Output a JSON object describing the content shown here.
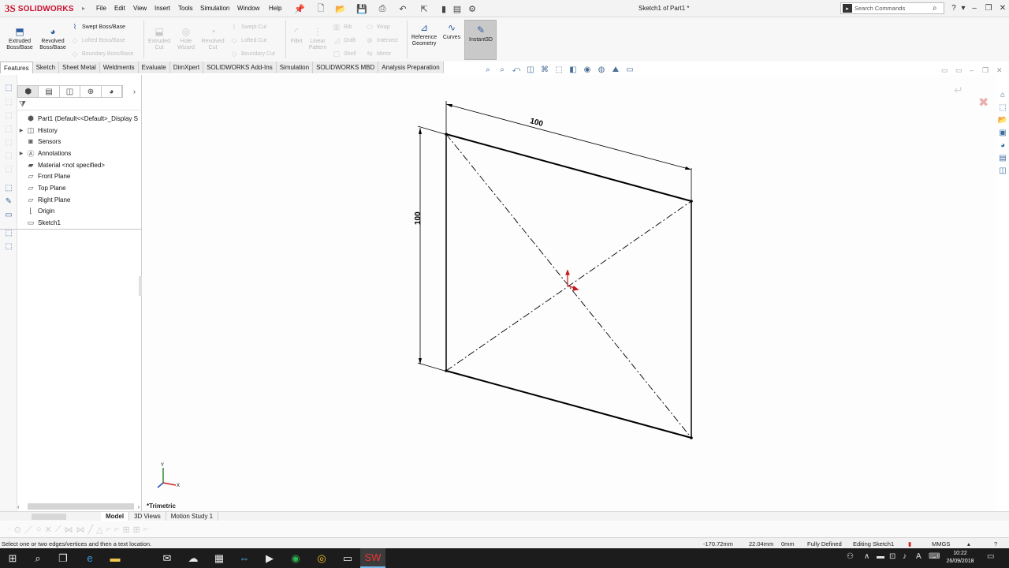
{
  "app": {
    "logo_ds": "3S",
    "logo_name": "SOLIDWORKS",
    "doc_title": "Sketch1 of Part1 *"
  },
  "menu": [
    "File",
    "Edit",
    "View",
    "Insert",
    "Tools",
    "Simulation",
    "Window",
    "Help"
  ],
  "search": {
    "placeholder": "Search Commands"
  },
  "ribbon": {
    "extruded_boss": "Extruded Boss/Base",
    "revolved_boss": "Revolved Boss/Base",
    "swept_boss": "Swept Boss/Base",
    "lofted_boss": "Lofted Boss/Base",
    "boundary_boss": "Boundary Boss/Base",
    "extruded_cut": "Extruded Cut",
    "hole_wizard": "Hole Wizard",
    "revolved_cut": "Revolved Cut",
    "swept_cut": "Swept Cut",
    "lofted_cut": "Lofted Cut",
    "boundary_cut": "Boundary Cut",
    "fillet": "Fillet",
    "linear_pattern": "Linear Pattern",
    "rib": "Rib",
    "draft": "Draft",
    "shell": "Shell",
    "wrap": "Wrap",
    "intersect": "Intersect",
    "mirror": "Mirror",
    "reference_geometry": "Reference Geometry",
    "curves": "Curves",
    "instant3d": "Instant3D"
  },
  "tabs": [
    "Features",
    "Sketch",
    "Sheet Metal",
    "Weldments",
    "Evaluate",
    "DimXpert",
    "SOLIDWORKS Add-Ins",
    "Simulation",
    "SOLIDWORKS MBD",
    "Analysis Preparation"
  ],
  "tree": [
    {
      "label": "Part1  (Default<<Default>_Display S",
      "icon": "part-icon"
    },
    {
      "label": "History",
      "icon": "history-icon"
    },
    {
      "label": "Sensors",
      "icon": "sensors-icon"
    },
    {
      "label": "Annotations",
      "icon": "annotations-icon"
    },
    {
      "label": "Material <not specified>",
      "icon": "material-icon"
    },
    {
      "label": "Front Plane",
      "icon": "plane-icon"
    },
    {
      "label": "Top Plane",
      "icon": "plane-icon"
    },
    {
      "label": "Right Plane",
      "icon": "plane-icon"
    },
    {
      "label": "Origin",
      "icon": "origin-icon"
    },
    {
      "label": "Sketch1",
      "icon": "sketch-icon"
    }
  ],
  "sketch": {
    "dim_top": "100",
    "dim_left": "100"
  },
  "triad": {
    "y": "Y",
    "x": "X"
  },
  "view_orientation": "*Trimetric",
  "model_tabs": [
    "Model",
    "3D Views",
    "Motion Study 1"
  ],
  "status": {
    "message": "Select one or two edges/vertices and then a text location.",
    "x": "-170.72mm",
    "y": "22.04mm",
    "z": "0mm",
    "state": "Fully Defined",
    "editing": "Editing Sketch1",
    "units": "MMGS"
  },
  "clock": {
    "time": "10:22",
    "date": "26/09/2018"
  }
}
